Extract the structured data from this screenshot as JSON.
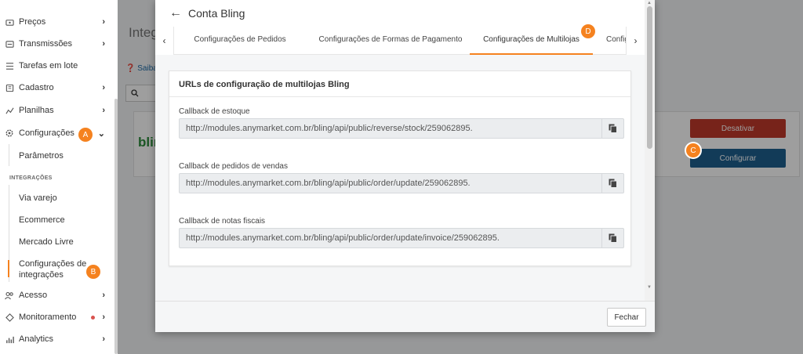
{
  "sidebar": {
    "items": [
      {
        "label": "Preços",
        "icon": "price-tag-icon"
      },
      {
        "label": "Transmissões",
        "icon": "transmission-icon"
      },
      {
        "label": "Tarefas em lote",
        "icon": "list-icon"
      },
      {
        "label": "Cadastro",
        "icon": "form-icon"
      },
      {
        "label": "Planilhas",
        "icon": "spreadsheet-icon"
      },
      {
        "label": "Configurações",
        "icon": "gear-icon"
      }
    ],
    "sub_parametros": "Parâmetros",
    "section_integracoes": "INTEGRAÇÕES",
    "integracoes": [
      "Via varejo",
      "Ecommerce",
      "Mercado Livre"
    ],
    "config_integracoes": "Configurações de integrações",
    "bottom_items": [
      {
        "label": "Acesso",
        "icon": "user-group-icon"
      },
      {
        "label": "Monitoramento",
        "icon": "diamond-icon"
      },
      {
        "label": "Analytics",
        "icon": "bar-chart-icon"
      }
    ]
  },
  "badges": {
    "a": "A",
    "b": "B",
    "c": "C",
    "d": "D"
  },
  "background": {
    "title_partial": "Integ",
    "saiba_partial": "Saiba",
    "logo_partial": "blin",
    "desativar": "Desativar",
    "configurar": "Configurar"
  },
  "modal": {
    "title": "Conta Bling",
    "tabs": [
      "Configurações de Pedidos",
      "Configurações de Formas de Pagamento",
      "Configurações de Multilojas",
      "Configu"
    ],
    "active_tab": 2,
    "panel_title": "URLs de configuração de multilojas Bling",
    "fields": [
      {
        "label": "Callback de estoque",
        "value": "http://modules.anymarket.com.br/bling/api/public/reverse/stock/259062895."
      },
      {
        "label": "Callback de pedidos de vendas",
        "value": "http://modules.anymarket.com.br/bling/api/public/order/update/259062895."
      },
      {
        "label": "Callback de notas fiscais",
        "value": "http://modules.anymarket.com.br/bling/api/public/order/update/invoice/259062895."
      }
    ],
    "close_label": "Fechar"
  },
  "colors": {
    "accent": "#f5821f",
    "primary": "#1e5f8e",
    "danger": "#c0392b",
    "bling_green": "#2b8b3a"
  }
}
